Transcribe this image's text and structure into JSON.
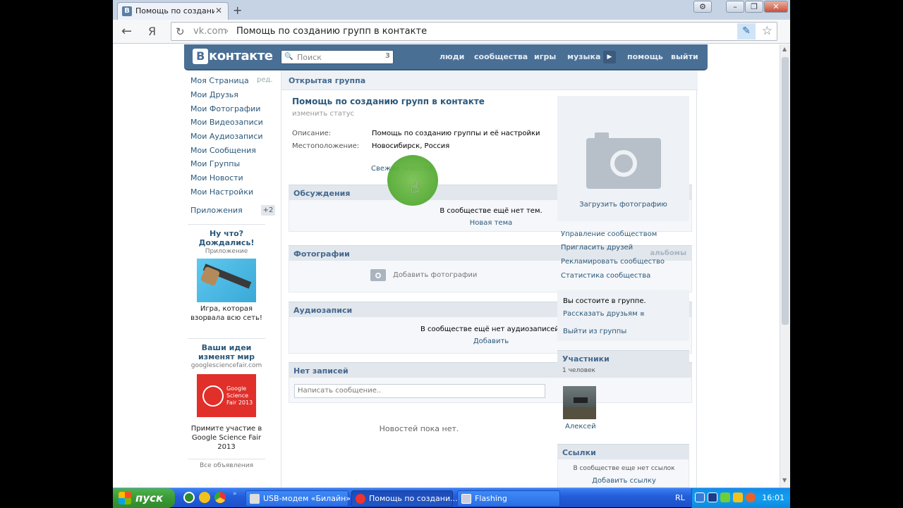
{
  "browser": {
    "tab_title": "Помощь по созданию гр",
    "url_domain": "vk.com",
    "url_separator": "›",
    "url_path": "Помощь по созданию групп в контакте",
    "yandex_label": "Я"
  },
  "vk_header": {
    "logo_letter": "В",
    "logo_text": "контакте",
    "search_placeholder": "Поиск",
    "search_count": "3",
    "nav": [
      "люди",
      "сообщества",
      "игры",
      "музыка",
      "помощь",
      "выйти"
    ]
  },
  "left_menu": {
    "items": [
      "Моя Страница",
      "Мои Друзья",
      "Мои Фотографии",
      "Мои Видеозаписи",
      "Мои Аудиозаписи",
      "Мои Сообщения",
      "Мои Группы",
      "Мои Новости",
      "Мои Настройки"
    ],
    "edit_label": "ред.",
    "apps_label": "Приложения",
    "apps_badge": "+2"
  },
  "ads": [
    {
      "title": "Ну что? Дождались!",
      "subtitle": "Приложение",
      "text": "Игра, которая взорвала всю сеть!"
    },
    {
      "title": "Ваши идеи изменят мир",
      "subtitle": "googlesciencefair.com",
      "image_text": "Google Science Fair 2013",
      "text": "Примите участие в Google Science Fair 2013"
    }
  ],
  "all_ads_label": "Все объявления",
  "group": {
    "type_label": "Открытая группа",
    "name": "Помощь по созданию групп в контакте",
    "change_status": "изменить статус",
    "desc_label": "Описание:",
    "desc_value": "Помощь по созданию группы и её настройки",
    "loc_label": "Местоположение:",
    "loc_value": "Новосибирск, Россия",
    "news_link": "Свежие новости"
  },
  "blocks": {
    "discussions": {
      "title": "Обсуждения",
      "empty": "В сообществе ещё нет тем.",
      "action": "Новая тема"
    },
    "photos": {
      "title": "Фотографии",
      "aside": "альбомы",
      "action": "Добавить фотографии"
    },
    "audio": {
      "title": "Аудиозаписи",
      "empty": "В сообществе ещё нет аудиозаписей.",
      "action": "Добавить"
    },
    "wall": {
      "title": "Нет записей",
      "placeholder": "Написать сообщение..",
      "empty": "Новостей пока нет."
    }
  },
  "right": {
    "upload_photo": "Загрузить фотографию",
    "admin_links": [
      "Управление сообществом",
      "Пригласить друзей",
      "Рекламировать сообщество",
      "Статистика сообщества"
    ],
    "member_text": "Вы состоите в группе.",
    "tell_friends": "Рассказать друзьям",
    "leave_group": "Выйти из группы",
    "members_title": "Участники",
    "members_count": "1 человек",
    "member_name": "Алексей",
    "links_title": "Ссылки",
    "links_empty": "В сообществе еще нет ссылок",
    "add_link": "Добавить ссылку"
  },
  "taskbar": {
    "start_label": "пуск",
    "items": [
      "USB-модем «Билайн»",
      "Помощь по создани...",
      "Flashing"
    ],
    "lang": "RL",
    "clock": "16:01"
  },
  "colors": {
    "vk_blue": "#4a6f95",
    "link": "#2b587a",
    "taskbar": "#245edb",
    "start": "#3a9a37"
  }
}
